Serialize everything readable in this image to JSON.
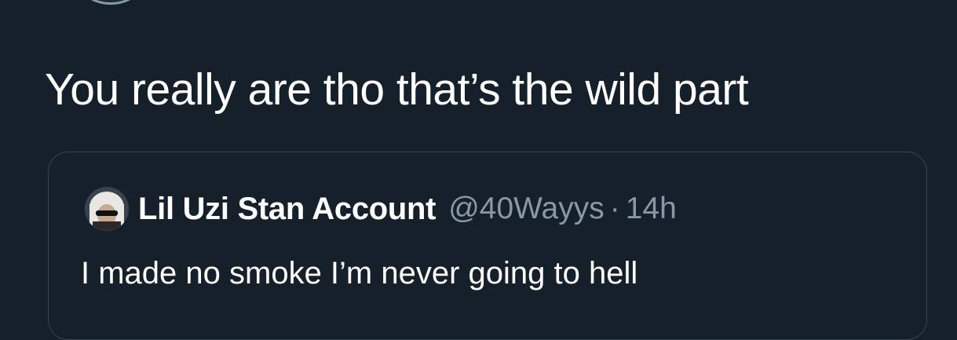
{
  "tweet": {
    "text": "You really are tho that’s the wild part"
  },
  "quote": {
    "author_name": "Lil Uzi Stan Account",
    "handle": "@40Wayys",
    "separator": "·",
    "time": "14h",
    "text": "I made no smoke I’m never going to hell"
  },
  "colors": {
    "background": "#15202b",
    "text_primary": "#ffffff",
    "text_secondary": "#8899a6",
    "border": "#38444d"
  }
}
